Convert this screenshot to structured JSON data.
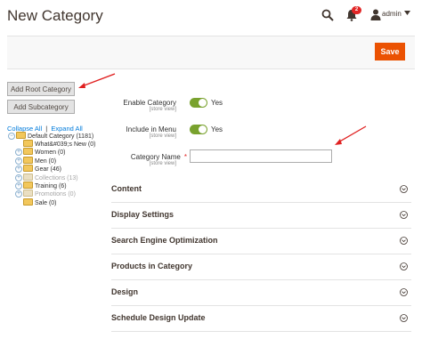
{
  "header": {
    "title": "New Category",
    "notification_count": "2",
    "user_name": "admin"
  },
  "toolbar": {
    "save_label": "Save"
  },
  "tree": {
    "add_root_label": "Add Root Category",
    "add_sub_label": "Add Subcategory",
    "collapse_all": "Collapse All",
    "separator": "|",
    "expand_all": "Expand All",
    "nodes": [
      {
        "label": "Default Category (1181)"
      },
      {
        "label": "What&#039;s New (0)"
      },
      {
        "label": "Women (0)"
      },
      {
        "label": "Men (0)"
      },
      {
        "label": "Gear (46)"
      },
      {
        "label": "Collections (13)"
      },
      {
        "label": "Training (6)"
      },
      {
        "label": "Promotions (0)"
      },
      {
        "label": "Sale (0)"
      }
    ]
  },
  "form": {
    "scope": "[store view]",
    "enable_category": {
      "label": "Enable Category",
      "value": "Yes"
    },
    "include_in_menu": {
      "label": "Include in Menu",
      "value": "Yes"
    },
    "category_name": {
      "label": "Category Name",
      "required": "*",
      "value": ""
    }
  },
  "sections": [
    {
      "title": "Content"
    },
    {
      "title": "Display Settings"
    },
    {
      "title": "Search Engine Optimization"
    },
    {
      "title": "Products in Category"
    },
    {
      "title": "Design"
    },
    {
      "title": "Schedule Design Update"
    }
  ],
  "colors": {
    "accent": "#eb5202",
    "toggle_on": "#79a22e",
    "link": "#007bdb",
    "annotation_arrow": "#e02020"
  }
}
